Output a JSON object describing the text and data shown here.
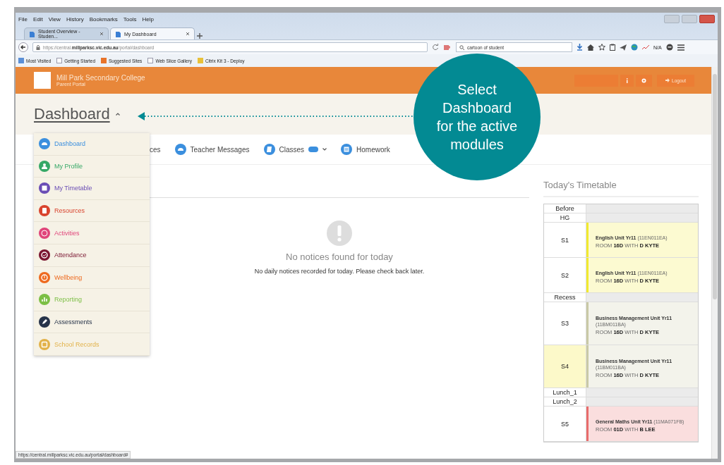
{
  "browser": {
    "menu": [
      "File",
      "Edit",
      "View",
      "History",
      "Bookmarks",
      "Tools",
      "Help"
    ],
    "tabs": [
      {
        "title": "Student Overview - Studen...",
        "selected": false
      },
      {
        "title": "My Dashboard",
        "selected": true
      }
    ],
    "url": "https://central.**millparksc.vic.edu.au**/portal/dashboard",
    "search": {
      "value": "cartoon of student"
    },
    "toolbar_text": "N/A",
    "bookmarks": [
      "Most Visited",
      "Getting Started",
      "Suggested Sites",
      "Web Slice Gallery",
      "Citrix Kit 3 - Deploy"
    ],
    "status_url": "https://central.millparksc.vic.edu.au/portal/dashboard#"
  },
  "header": {
    "school": "Mill Park Secondary College",
    "subtitle": "Parent Portal",
    "logout": "Logout"
  },
  "page": {
    "title": "Dashboard",
    "nav": [
      {
        "label": "ces",
        "kind": "cut"
      },
      {
        "label": "Teacher Messages",
        "kind": "link"
      },
      {
        "label": "Classes",
        "kind": "dropdown"
      },
      {
        "label": "Homework",
        "kind": "link"
      }
    ],
    "notice": {
      "title": "No notices found for today",
      "message": "No daily notices recorded for today. Please check back later."
    }
  },
  "menu": [
    {
      "label": "Dashboard",
      "color": "#3b8fde"
    },
    {
      "label": "My Profile",
      "color": "#35a866"
    },
    {
      "label": "My Timetable",
      "color": "#6a4db5"
    },
    {
      "label": "Resources",
      "color": "#d9442e"
    },
    {
      "label": "Activities",
      "color": "#e0457a"
    },
    {
      "label": "Attendance",
      "color": "#7a1530"
    },
    {
      "label": "Wellbeing",
      "color": "#ee6a1f"
    },
    {
      "label": "Reporting",
      "color": "#7cbf45"
    },
    {
      "label": "Assessments",
      "color": "#263349"
    },
    {
      "label": "School Records",
      "color": "#e2b24a"
    }
  ],
  "timetable": {
    "title": "Today's Timetable",
    "rows": [
      {
        "kind": "break",
        "period": "Before"
      },
      {
        "kind": "break",
        "period": "HG"
      },
      {
        "kind": "class",
        "period": "S1",
        "current": false,
        "subject": "English Unit Yr11",
        "code": "(11EN011EA)",
        "room": "ROOM **16D** WITH **D KYTE**",
        "color": "#f2ea2e"
      },
      {
        "kind": "class",
        "period": "S2",
        "current": false,
        "subject": "English Unit Yr11",
        "code": "(11EN011EA)",
        "room": "ROOM **16D** WITH **D KYTE**",
        "color": "#f2ea2e"
      },
      {
        "kind": "break",
        "period": "Recess"
      },
      {
        "kind": "class",
        "period": "S3",
        "current": false,
        "subject": "Business Management Unit Yr11",
        "code": "(11BM011BA)",
        "room": "ROOM **16D** WITH **D KYTE**",
        "color": "#c9c9a6"
      },
      {
        "kind": "class",
        "period": "S4",
        "current": true,
        "subject": "Business Management Unit Yr11",
        "code": "(11BM011BA)",
        "room": "ROOM **16D** WITH **D KYTE**",
        "color": "#c9c9a6"
      },
      {
        "kind": "break",
        "period": "Lunch_1"
      },
      {
        "kind": "break",
        "period": "Lunch_2"
      },
      {
        "kind": "class",
        "period": "S5",
        "current": false,
        "subject": "General Maths Unit Yr11",
        "code": "(11MA071FB)",
        "room": "ROOM **01D** WITH **B LEE**",
        "color": "#e86b6b"
      }
    ]
  },
  "callout": {
    "text": "Select Dashboard for the active modules"
  }
}
